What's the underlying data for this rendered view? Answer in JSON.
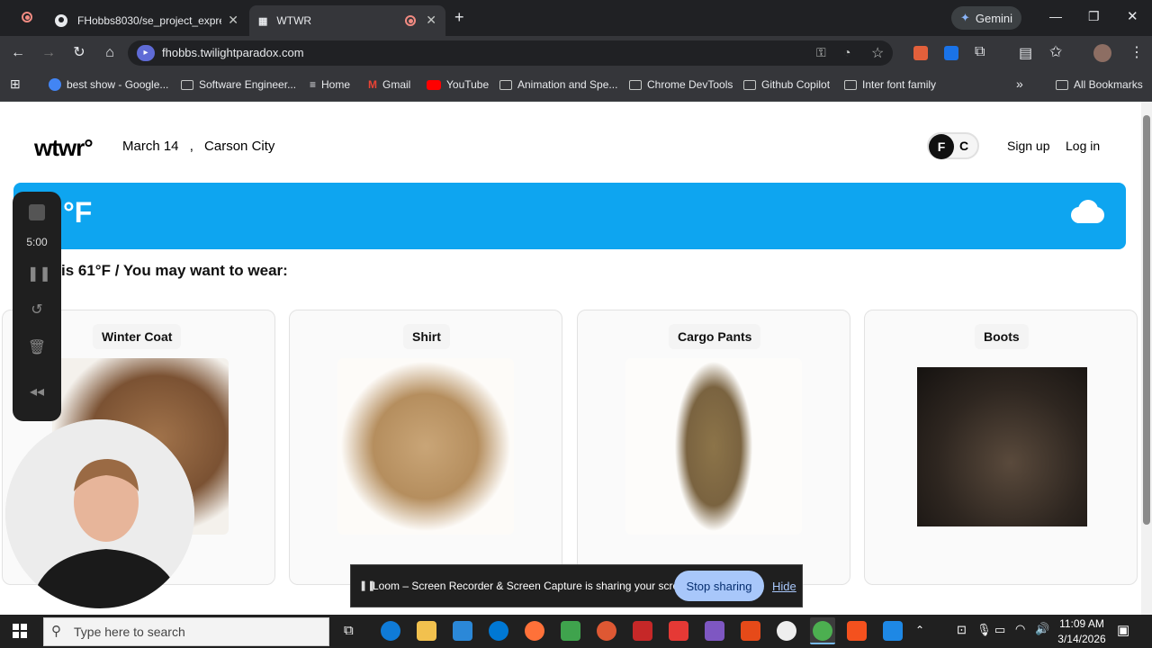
{
  "browser": {
    "tabs": [
      {
        "title": "FHobbs8030/se_project_expres",
        "icon": "github-icon"
      },
      {
        "title": "WTWR",
        "icon": "wtwr-favicon"
      }
    ],
    "new_tab_label": "+",
    "gemini_label": "Gemini",
    "url": "fhobbs.twilightparadox.com",
    "bookmarks": [
      "best show - Google...",
      "Software Engineer...",
      "Home",
      "Gmail",
      "YouTube",
      "Animation and Spe...",
      "Chrome DevTools",
      "Github Copilot",
      "Inter font family"
    ],
    "all_bookmarks": "All Bookmarks"
  },
  "header": {
    "logo": "wtwr°",
    "date": "March 14",
    "separator": ",",
    "city": "Carson City",
    "unit_toggle": {
      "active": "F",
      "inactive": "C"
    },
    "signup": "Sign up",
    "login": "Log in"
  },
  "weather": {
    "temp_display": "°F",
    "suggestion": "is 61°F / You may want to wear:"
  },
  "items": [
    {
      "name": "Winter Coat"
    },
    {
      "name": "Shirt"
    },
    {
      "name": "Cargo Pants"
    },
    {
      "name": "Boots"
    }
  ],
  "loom": {
    "timer": "5:00",
    "banner_text": "Loom – Screen Recorder & Screen Capture is sharing your screen.",
    "stop_label": "Stop sharing",
    "hide_label": "Hide"
  },
  "taskbar": {
    "search_placeholder": "Type here to search",
    "time": "11:09 AM",
    "date": "3/14/2026"
  },
  "colors": {
    "weather_card": "#0ea5f0",
    "accent": "#a8c7fa"
  }
}
